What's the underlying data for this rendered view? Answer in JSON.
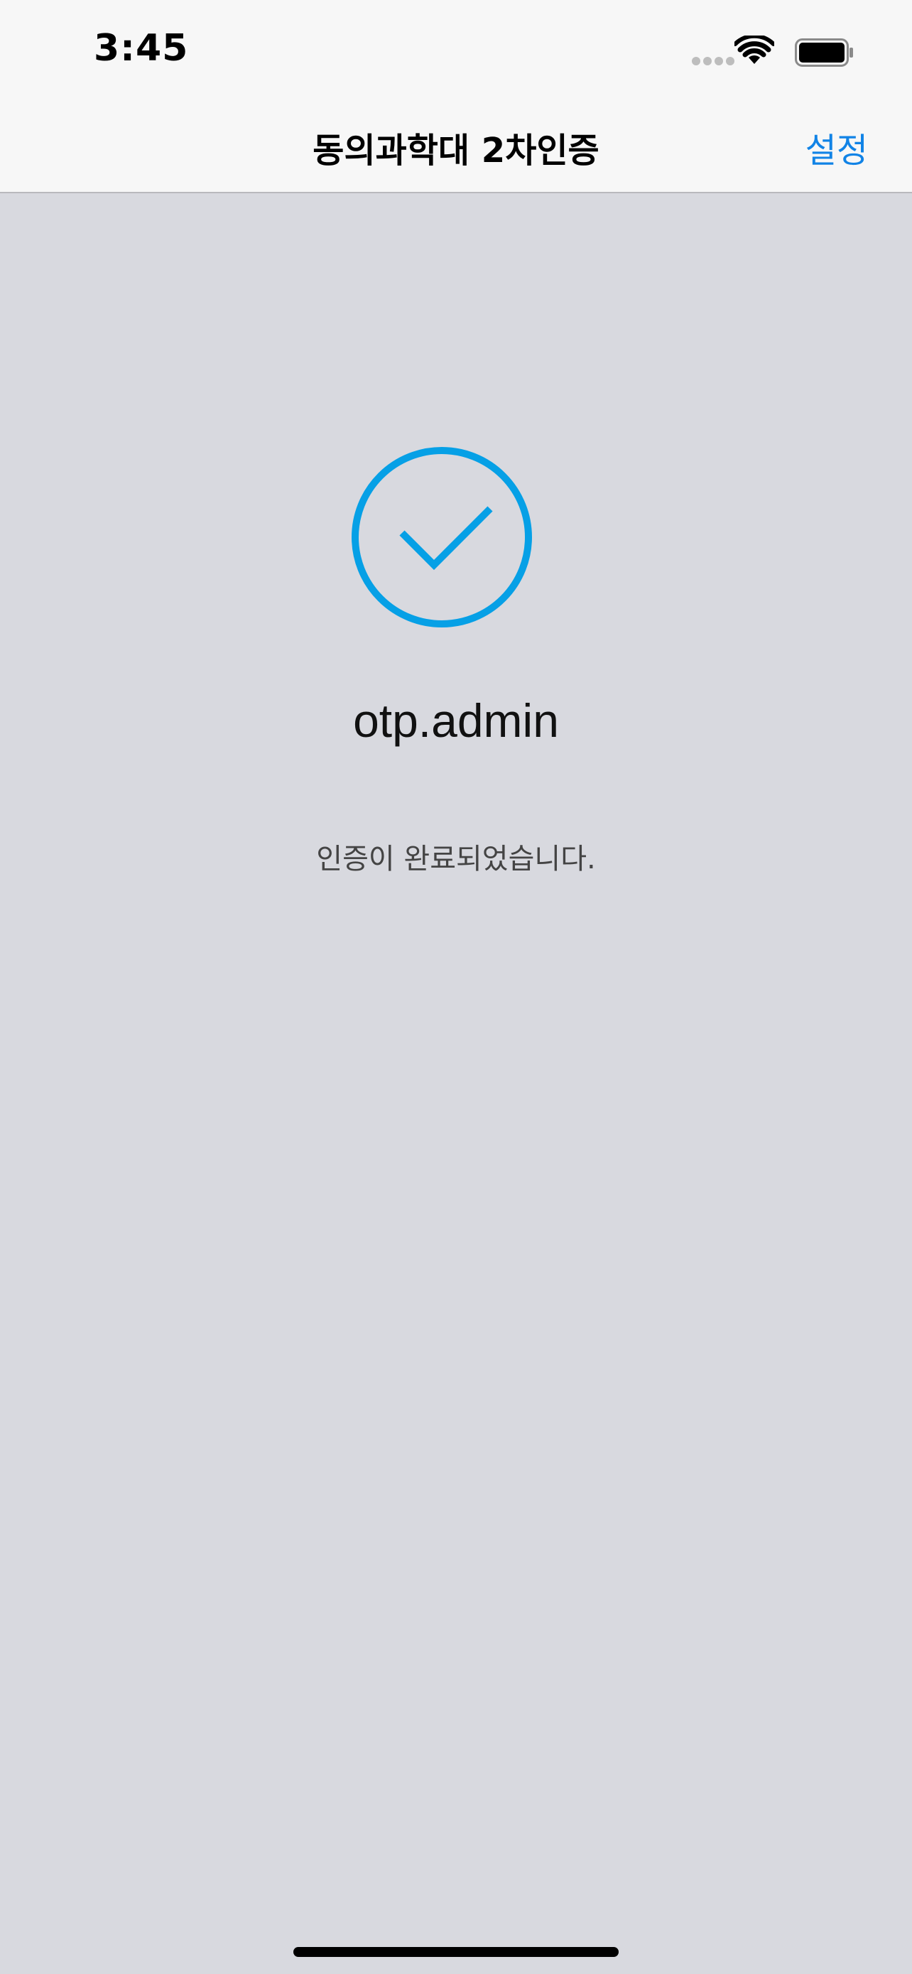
{
  "status_bar": {
    "time": "3:45",
    "icons": [
      "signal-dots-icon",
      "wifi-icon",
      "battery-icon"
    ]
  },
  "nav": {
    "title": "동의과학대 2차인증",
    "settings_label": "설정"
  },
  "main": {
    "status_icon": "checkmark-circle-icon",
    "username": "otp.admin",
    "message": "인증이 완료되었습니다."
  },
  "colors": {
    "accent": "#1183e6",
    "check": "#06a0e6",
    "background": "#d8d9df",
    "header": "#f7f7f7"
  }
}
